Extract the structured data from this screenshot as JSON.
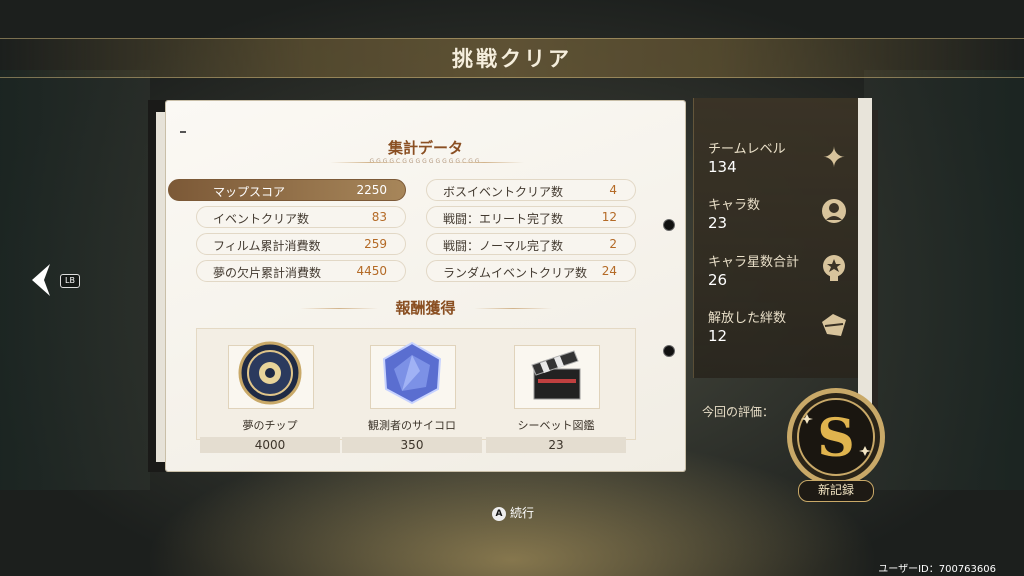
{
  "header": {
    "title": "挑戦クリア"
  },
  "summary": {
    "title": "集計データ",
    "subtitle": "GGGGCGGGGGGGGGCGG",
    "left_stats": [
      {
        "label": "マップスコア",
        "value": "2250"
      },
      {
        "label": "イベントクリア数",
        "value": "83"
      },
      {
        "label": "フィルム累計消費数",
        "value": "259"
      },
      {
        "label": "夢の欠片累計消費数",
        "value": "4450"
      }
    ],
    "right_stats": [
      {
        "label": "ボスイベントクリア数",
        "value": "4"
      },
      {
        "label": "戦闘：エリート完了数",
        "value": "12"
      },
      {
        "label": "戦闘：ノーマル完了数",
        "value": "2"
      },
      {
        "label": "ランダムイベントクリア数",
        "value": "24"
      }
    ]
  },
  "rewards": {
    "title": "報酬獲得",
    "items": [
      {
        "name": "夢のチップ",
        "count": "4000",
        "icon": "chip-icon"
      },
      {
        "name": "観測者のサイコロ",
        "count": "350",
        "icon": "dice-icon"
      },
      {
        "name": "シーベット図鑑",
        "count": "23",
        "icon": "clapperboard-icon"
      }
    ]
  },
  "side": {
    "stats": [
      {
        "label": "チームレベル",
        "value": "134",
        "icon": "sparkle-icon"
      },
      {
        "label": "キャラ数",
        "value": "23",
        "icon": "character-icon"
      },
      {
        "label": "キャラ星数合計",
        "value": "26",
        "icon": "star-bulb-icon"
      },
      {
        "label": "解放した絆数",
        "value": "12",
        "icon": "bond-icon"
      }
    ],
    "eval_label": "今回の評価：",
    "rank": "S",
    "new_record": "新記録"
  },
  "nav": {
    "lb": "LB"
  },
  "footer": {
    "continue_button": "A",
    "continue_label": "続行",
    "user_id": "ユーザーID：700763606"
  },
  "colors": {
    "accent": "#b46a26",
    "active_row": "#7c5937",
    "gold": "#c9a968"
  }
}
